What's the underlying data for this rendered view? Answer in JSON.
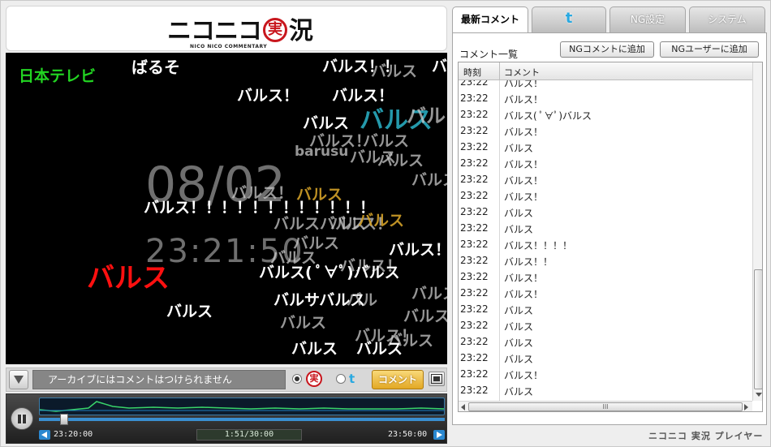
{
  "logo": {
    "text_left": "ニコニコ",
    "seal": "実",
    "text_right": "況",
    "subtitle": "NICO   NICO   COMMENTARY"
  },
  "video": {
    "channel": "日本テレビ",
    "clock_date": "08/02",
    "clock_time": "23:21:50",
    "overlay_comments": [
      "ばるそ",
      "バルス！！",
      "バ",
      "バルス",
      "バルス！",
      "バルス！",
      "バルス",
      "バルス",
      "バルス",
      "バルス！",
      "バルス",
      "barusu",
      "バルス",
      "バルス",
      "バルス",
      "バルス！",
      "バルス",
      "バルス！！！！！！！！！！！！",
      "バルスバルス",
      "バルス！",
      "バルス",
      "バルス",
      "バルス！",
      "バルス",
      "バルス！",
      "バルス",
      "バルス( ﾟ∀ﾟ)バルス",
      "バルス",
      "バルサバルス",
      "バルス",
      "バルス！",
      "バル",
      "バルス！",
      "バルス",
      "バルス",
      "バルス",
      "バルス"
    ]
  },
  "controls": {
    "comment_input_placeholder": "アーカイブにはコメントはつけられません",
    "seal": "実",
    "twitter_glyph": "t",
    "comment_toggle": "コメント"
  },
  "seek": {
    "start_time": "23:20:00",
    "current_time": "1:51/30:00",
    "end_time": "23:50:00",
    "progress_fraction": 0.062
  },
  "tabs": [
    {
      "label": "最新コメント"
    },
    {
      "label": "t"
    },
    {
      "label": "NG設定"
    },
    {
      "label": "システム"
    }
  ],
  "panel": {
    "title": "コメント一覧",
    "ng_comment_button": "NGコメントに追加",
    "ng_user_button": "NGユーザーに追加",
    "col_time": "時刻",
    "col_comment": "コメント",
    "hscroll_grip": "III",
    "rows": [
      {
        "time": "23:22",
        "comment": "バルス！"
      },
      {
        "time": "23:22",
        "comment": "バルス！"
      },
      {
        "time": "23:22",
        "comment": "バルス( ﾟ∀ﾟ)バルス"
      },
      {
        "time": "23:22",
        "comment": "バルス！"
      },
      {
        "time": "23:22",
        "comment": "バルス"
      },
      {
        "time": "23:22",
        "comment": "バルス！"
      },
      {
        "time": "23:22",
        "comment": "バルス！"
      },
      {
        "time": "23:22",
        "comment": "バルス！"
      },
      {
        "time": "23:22",
        "comment": "バルス"
      },
      {
        "time": "23:22",
        "comment": "バルス"
      },
      {
        "time": "23:22",
        "comment": "バルス！！！！"
      },
      {
        "time": "23:22",
        "comment": "バルス！！"
      },
      {
        "time": "23:22",
        "comment": "バルス！"
      },
      {
        "time": "23:22",
        "comment": "バルス！"
      },
      {
        "time": "23:22",
        "comment": "バルス"
      },
      {
        "time": "23:22",
        "comment": "バルス"
      },
      {
        "time": "23:22",
        "comment": "バルス"
      },
      {
        "time": "23:22",
        "comment": "バルス"
      },
      {
        "time": "23:22",
        "comment": "バルス！"
      },
      {
        "time": "23:22",
        "comment": "バルス"
      },
      {
        "time": "23:22",
        "comment": "バルス"
      }
    ]
  },
  "footer": {
    "brand": "ニコニコ 実況 プレイヤー"
  },
  "colors": {
    "accent_red": "#c8161d",
    "twitter_blue": "#29a9e1",
    "seek_blue": "#3a8fd0",
    "comment_toggle": "#e3a824"
  }
}
